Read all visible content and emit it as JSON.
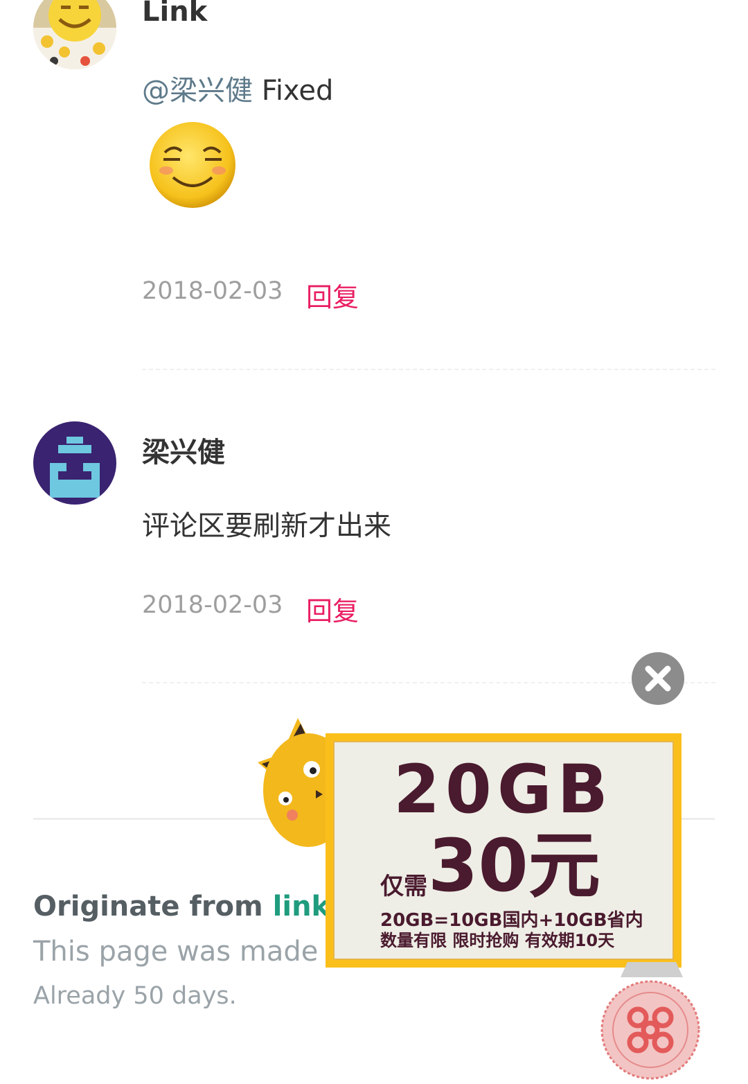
{
  "comments": [
    {
      "author": "Link",
      "mention": "@梁兴健",
      "text": " Fixed",
      "sticker": "grinning-smiley-sticker",
      "date": "2018-02-03",
      "reply_label": "回复",
      "avatar": "smiley-collage-avatar"
    },
    {
      "author": "梁兴健",
      "text": "评论区要刷新才出来",
      "date": "2018-02-03",
      "reply_label": "回复",
      "avatar": "pixel-identicon-avatar"
    }
  ],
  "footer": {
    "originate_prefix": "Originate from ",
    "originate_link": "link",
    "originate_suffix": ".",
    "made_by": "This page was made b",
    "days": "Already 50 days."
  },
  "ad": {
    "headline": "20GB",
    "price_lead": "仅需",
    "price": "30元",
    "detail_1": "20GB=10GB国内+10GB省内",
    "detail_2": "数量有限 限时抢购 有效期10天",
    "close_icon": "close-icon",
    "colors": {
      "border": "#fbbf1c",
      "text": "#4a1a2e",
      "background": "#eeeee6"
    }
  },
  "colors": {
    "reply": "#e91e63",
    "link": "#1f9c7e",
    "date": "#9e9e9e"
  }
}
